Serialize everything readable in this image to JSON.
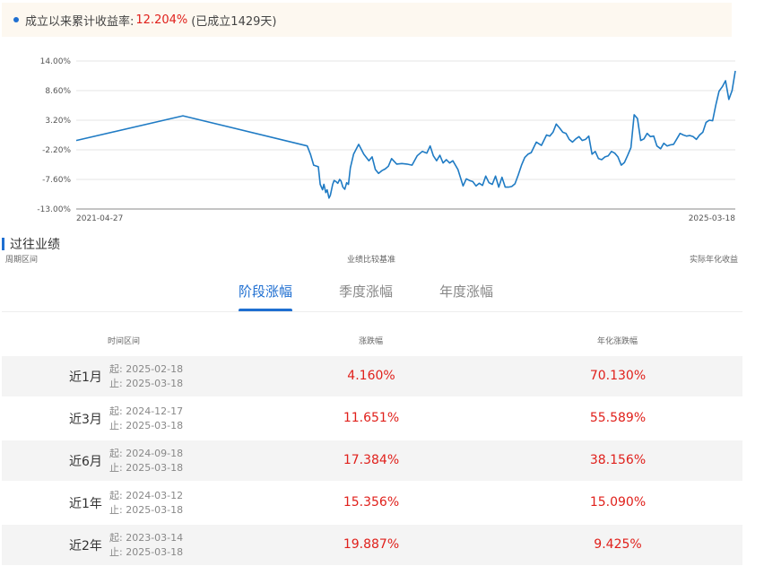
{
  "banner": {
    "label": "成立以来累计收益率:",
    "value": "12.204%",
    "suffix": "(已成立1429天)"
  },
  "chart_data": {
    "type": "line",
    "y_ticks": [
      "14.00%",
      "8.60%",
      "3.20%",
      "-2.20%",
      "-7.60%",
      "-13.00%"
    ],
    "ylim": [
      -13.0,
      14.0
    ],
    "x_start_label": "2021-04-27",
    "x_end_label": "2025-03-18",
    "color": "#1f7bc4",
    "grid": true,
    "series": [
      {
        "x": [
          "2021-04-27",
          "2021-12-13",
          "2022-09-07",
          "2022-09-14",
          "2022-09-21",
          "2022-10-01",
          "2022-10-05",
          "2022-10-10",
          "2022-10-13",
          "2022-10-17",
          "2022-10-20",
          "2022-10-24",
          "2022-10-27",
          "2022-11-01",
          "2022-11-04",
          "2022-11-08",
          "2022-11-12",
          "2022-11-16",
          "2022-11-19",
          "2022-11-23",
          "2022-11-27",
          "2022-12-01",
          "2022-12-05",
          "2022-12-09",
          "2022-12-16",
          "2022-12-27",
          "2023-01-07",
          "2023-01-18",
          "2023-01-25",
          "2023-02-01",
          "2023-02-08",
          "2023-02-15",
          "2023-02-22",
          "2023-03-01",
          "2023-03-08",
          "2023-03-19",
          "2023-03-30",
          "2023-04-10",
          "2023-04-21",
          "2023-05-02",
          "2023-05-13",
          "2023-05-23",
          "2023-05-30",
          "2023-06-06",
          "2023-06-13",
          "2023-06-20",
          "2023-06-27",
          "2023-07-04",
          "2023-07-11",
          "2023-07-18",
          "2023-07-29",
          "2023-08-09",
          "2023-08-16",
          "2023-08-23",
          "2023-08-30",
          "2023-09-06",
          "2023-09-13",
          "2023-09-20",
          "2023-09-27",
          "2023-10-04",
          "2023-10-11",
          "2023-10-18",
          "2023-10-25",
          "2023-11-01",
          "2023-11-08",
          "2023-11-15",
          "2023-11-22",
          "2023-11-29",
          "2023-12-06",
          "2023-12-13",
          "2023-12-20",
          "2023-12-27",
          "2024-01-03",
          "2024-01-14",
          "2024-01-25",
          "2024-02-05",
          "2024-02-12",
          "2024-02-19",
          "2024-02-26",
          "2024-03-04",
          "2024-03-11",
          "2024-03-18",
          "2024-03-25",
          "2024-04-01",
          "2024-04-08",
          "2024-04-15",
          "2024-04-22",
          "2024-04-29",
          "2024-05-06",
          "2024-05-13",
          "2024-05-20",
          "2024-05-27",
          "2024-06-03",
          "2024-06-10",
          "2024-06-17",
          "2024-06-24",
          "2024-07-01",
          "2024-07-08",
          "2024-07-15",
          "2024-07-22",
          "2024-07-29",
          "2024-08-05",
          "2024-08-12",
          "2024-08-19",
          "2024-08-26",
          "2024-09-02",
          "2024-09-09",
          "2024-09-16",
          "2024-09-23",
          "2024-09-30",
          "2024-10-08",
          "2024-10-15",
          "2024-10-22",
          "2024-10-29",
          "2024-11-05",
          "2024-11-12",
          "2024-11-19",
          "2024-11-26",
          "2024-12-03",
          "2024-12-10",
          "2024-12-17",
          "2024-12-24",
          "2024-12-31",
          "2025-01-07",
          "2025-01-14",
          "2025-01-21",
          "2025-01-28",
          "2025-02-04",
          "2025-02-11",
          "2025-02-18",
          "2025-02-25",
          "2025-03-04",
          "2025-03-11",
          "2025-03-18"
        ],
        "y": [
          -0.5,
          4.0,
          -1.5,
          -3.0,
          -5.0,
          -5.3,
          -8.5,
          -9.5,
          -8.5,
          -10.0,
          -9.5,
          -11.0,
          -10.5,
          -8.5,
          -7.8,
          -8.0,
          -8.3,
          -7.6,
          -7.9,
          -9.0,
          -9.4,
          -8.2,
          -8.5,
          -5.5,
          -3.0,
          -1.2,
          -3.0,
          -4.2,
          -3.5,
          -5.8,
          -6.5,
          -6.0,
          -5.7,
          -5.2,
          -3.8,
          -4.8,
          -4.7,
          -4.8,
          -5.0,
          -3.3,
          -2.5,
          -2.8,
          -1.5,
          -3.3,
          -4.2,
          -3.2,
          -4.6,
          -4.0,
          -4.6,
          -4.2,
          -5.8,
          -8.8,
          -7.5,
          -7.8,
          -8.0,
          -8.8,
          -8.3,
          -8.7,
          -7.0,
          -8.2,
          -8.5,
          -7.0,
          -9.0,
          -7.2,
          -9.0,
          -9.0,
          -8.9,
          -8.4,
          -6.8,
          -5.0,
          -3.6,
          -3.0,
          -2.7,
          -0.8,
          -1.4,
          0.5,
          0.3,
          1.0,
          2.5,
          1.8,
          1.0,
          0.8,
          -0.3,
          -0.8,
          -0.2,
          0.2,
          -0.5,
          -0.3,
          0.3,
          -3.0,
          -2.5,
          -3.8,
          -4.0,
          -3.5,
          -3.3,
          -2.5,
          -2.8,
          -3.5,
          -5.0,
          -4.5,
          -3.2,
          -1.8,
          4.2,
          3.5,
          -0.5,
          -0.2,
          0.8,
          0.2,
          0.3,
          -1.5,
          -2.0,
          -1.0,
          -1.5,
          -1.3,
          -1.2,
          -0.2,
          0.8,
          0.5,
          0.3,
          0.4,
          0.2,
          -0.3,
          0.5,
          1.0,
          2.8,
          3.2,
          3.1,
          6.0,
          8.5,
          9.3,
          10.4,
          7.0,
          8.6,
          12.2
        ]
      }
    ]
  },
  "section": {
    "title": "过往业绩",
    "sub_left": "周期区间",
    "sub_mid": "业绩比较基准",
    "sub_right": "实际年化收益"
  },
  "tabs": [
    {
      "label": "阶段涨幅",
      "active": true
    },
    {
      "label": "季度涨幅",
      "active": false
    },
    {
      "label": "年度涨幅",
      "active": false
    }
  ],
  "table": {
    "headers": [
      "时间区间",
      "涨跌幅",
      "年化涨跌幅"
    ],
    "rows": [
      {
        "period": "近1月",
        "start": "起:  2025-02-18",
        "end": "止:  2025-03-18",
        "change": "4.160%",
        "annual": "70.130%"
      },
      {
        "period": "近3月",
        "start": "起:  2024-12-17",
        "end": "止:  2025-03-18",
        "change": "11.651%",
        "annual": "55.589%"
      },
      {
        "period": "近6月",
        "start": "起:  2024-09-18",
        "end": "止:  2025-03-18",
        "change": "17.384%",
        "annual": "38.156%"
      },
      {
        "period": "近1年",
        "start": "起:  2024-03-12",
        "end": "止:  2025-03-18",
        "change": "15.356%",
        "annual": "15.090%"
      },
      {
        "period": "近2年",
        "start": "起:  2023-03-14",
        "end": "止:  2025-03-18",
        "change": "19.887%",
        "annual": "9.425%"
      }
    ]
  }
}
